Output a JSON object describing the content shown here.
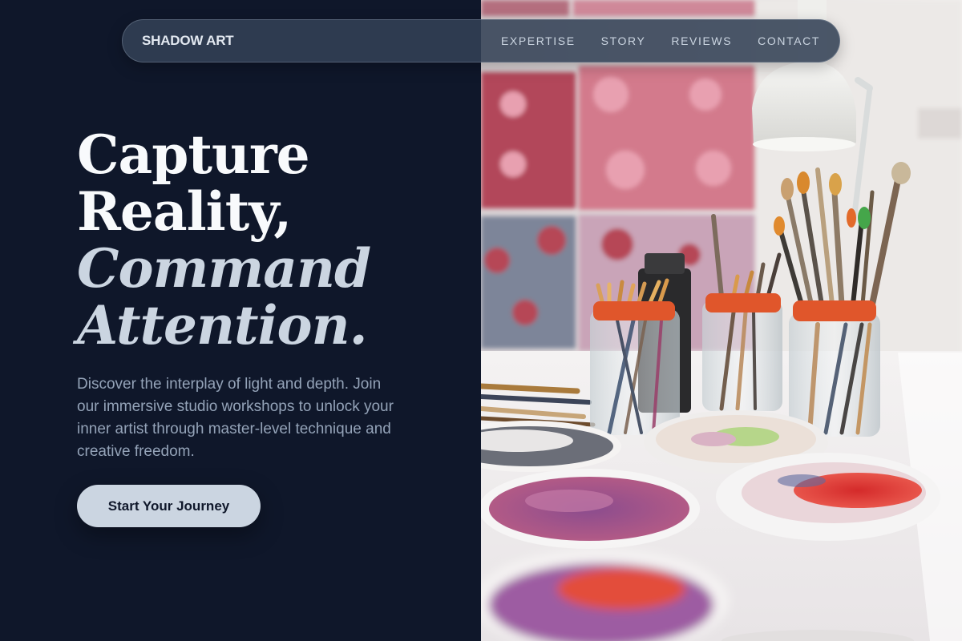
{
  "brand": {
    "name": "SHADOW ART"
  },
  "nav": {
    "links": [
      {
        "label": "EXPERTISE"
      },
      {
        "label": "STORY"
      },
      {
        "label": "REVIEWS"
      },
      {
        "label": "CONTACT"
      }
    ]
  },
  "hero": {
    "title_line1": "Capture",
    "title_line2": "Reality,",
    "title_line3": "Command",
    "title_line4": "Attention.",
    "description": "Discover the interplay of light and depth. Join our immersive studio workshops to unlock your inner artist through master-level technique and creative freedom.",
    "cta_label": "Start Your Journey"
  },
  "colors": {
    "background": "#0f172a",
    "nav_background": "#334155",
    "title": "#f8fafc",
    "title_italic": "#cbd5e1",
    "text_muted": "#94a3b8",
    "button": "#cbd5e1"
  },
  "image": {
    "subject": "artist-studio-paint-brushes-photo"
  }
}
